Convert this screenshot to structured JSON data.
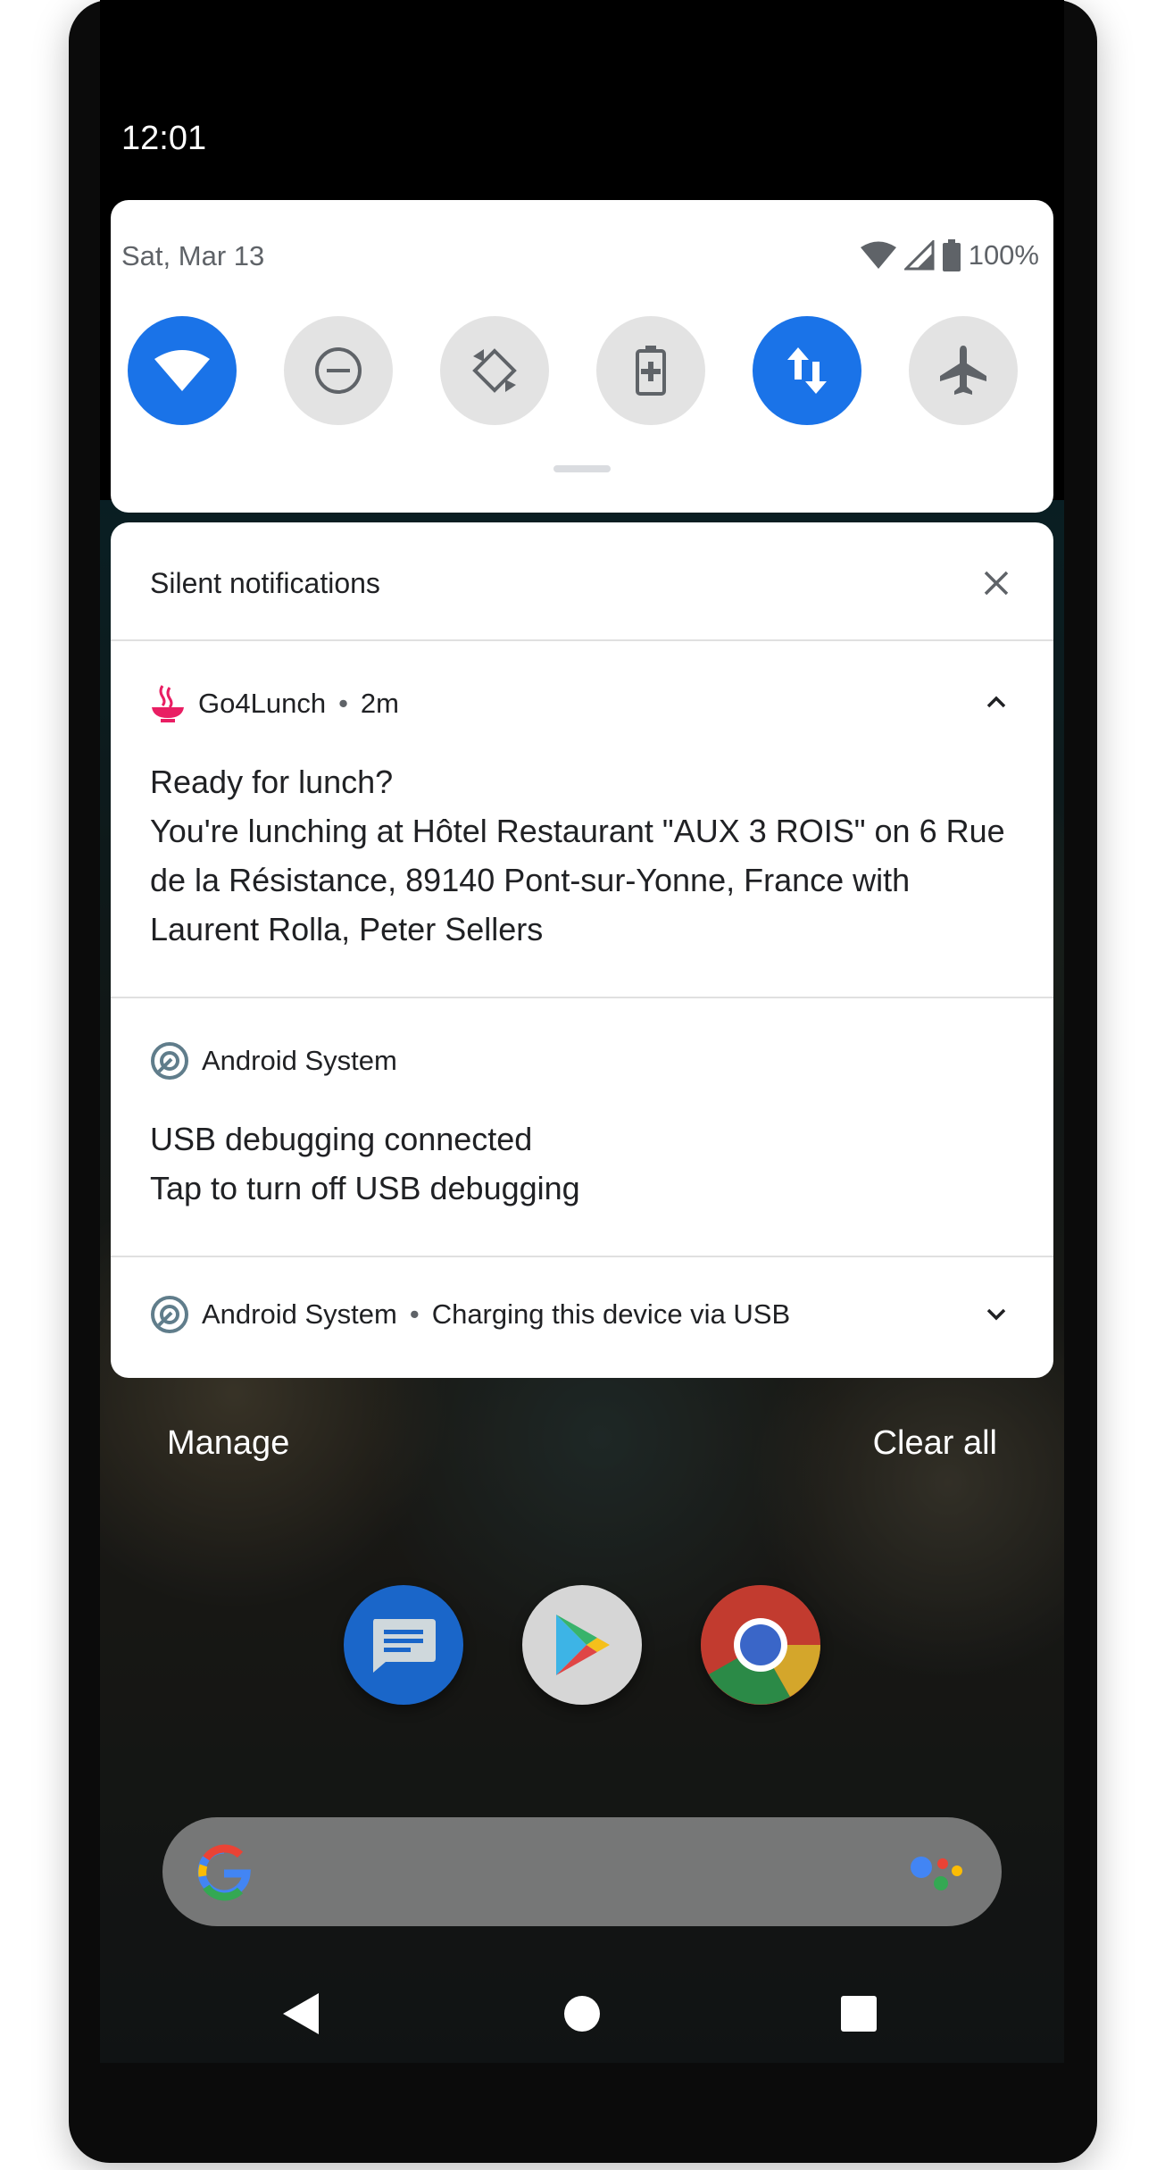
{
  "status_bar": {
    "time": "12:01"
  },
  "quick_settings": {
    "date": "Sat, Mar 13",
    "battery": "100%",
    "tiles": [
      {
        "name": "wifi-icon",
        "state": "on"
      },
      {
        "name": "do-not-disturb-icon",
        "state": "off"
      },
      {
        "name": "auto-rotate-icon",
        "state": "off"
      },
      {
        "name": "battery-saver-icon",
        "state": "off"
      },
      {
        "name": "mobile-data-icon",
        "state": "on"
      },
      {
        "name": "airplane-mode-icon",
        "state": "off"
      }
    ],
    "accent_color": "#1a73e8"
  },
  "notifications": {
    "section_title": "Silent notifications",
    "items": [
      {
        "app": "Go4Lunch",
        "time": "2m",
        "title": "Ready for lunch?",
        "text": "You're lunching at Hôtel Restaurant \"AUX 3 ROIS\" on 6 Rue de la Résistance, 89140 Pont-sur-Yonne, France with Laurent Rolla, Peter Sellers",
        "icon": "go4lunch-bowl-icon",
        "icon_color": "#e91e63"
      },
      {
        "app": "Android System",
        "title": "USB debugging connected",
        "text": "Tap to turn off USB debugging",
        "icon": "android-system-icon"
      },
      {
        "app": "Android System",
        "summary": "Charging this device via USB",
        "icon": "android-system-icon"
      }
    ]
  },
  "footer": {
    "manage": "Manage",
    "clear_all": "Clear all"
  },
  "home": {
    "apps": [
      "messages-icon",
      "play-store-icon",
      "chrome-icon"
    ]
  },
  "navigation": {
    "buttons": [
      "back-icon",
      "home-icon",
      "recents-icon"
    ]
  }
}
